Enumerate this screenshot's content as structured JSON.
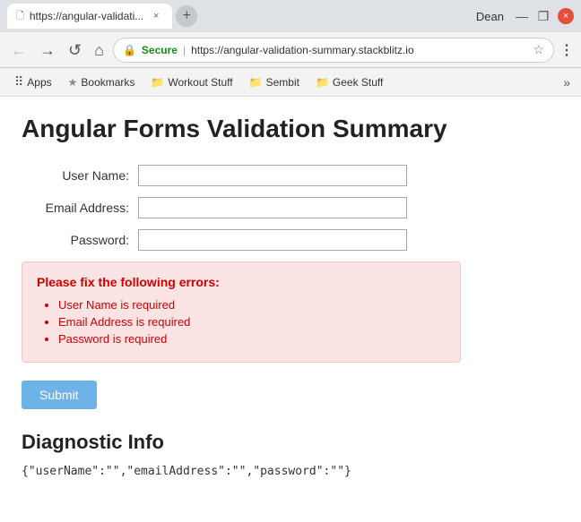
{
  "window": {
    "title_bar": {
      "tab_url": "https://angular-validati...",
      "tab_close_label": "×",
      "new_tab_label": "+",
      "user_name": "Dean",
      "minimize_icon": "—",
      "restore_icon": "❐",
      "close_icon": "×"
    },
    "toolbar": {
      "back_icon": "←",
      "forward_icon": "→",
      "reload_icon": "↺",
      "home_icon": "⌂",
      "secure_label": "Secure",
      "url": "https://angular-validation-summary.stackblitz.io",
      "star_icon": "☆",
      "menu_icon": "⋮"
    },
    "bookmarks": {
      "apps_label": "Apps",
      "bookmarks_label": "Bookmarks",
      "items": [
        {
          "label": "Workout Stuff",
          "icon": "📁"
        },
        {
          "label": "Sembit",
          "icon": "📁"
        },
        {
          "label": "Geek Stuff",
          "icon": "📁"
        }
      ],
      "overflow_icon": "»"
    }
  },
  "page": {
    "title": "Angular Forms Validation Summary",
    "form": {
      "username_label": "User Name:",
      "email_label": "Email Address:",
      "password_label": "Password:",
      "username_value": "",
      "email_value": "",
      "password_value": ""
    },
    "error_box": {
      "header": "Please fix the following errors:",
      "errors": [
        "User Name is required",
        "Email Address is required",
        "Password is required"
      ]
    },
    "submit_button": "Submit",
    "diagnostic": {
      "title": "Diagnostic Info",
      "json": "{\"userName\":\"\",\"emailAddress\":\"\",\"password\":\"\"}"
    }
  }
}
